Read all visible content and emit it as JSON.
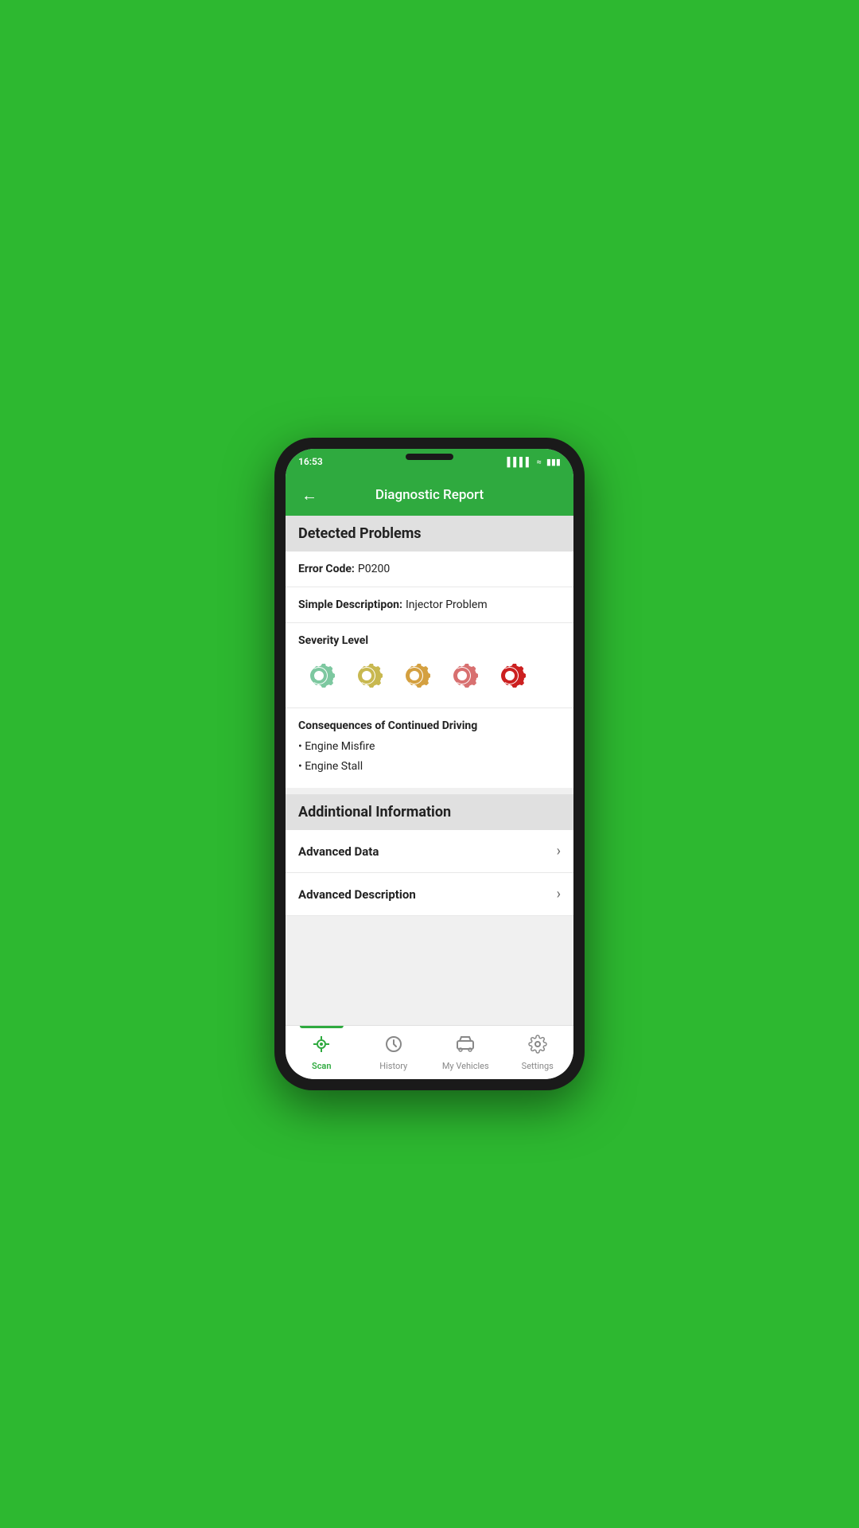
{
  "status_bar": {
    "time": "16:53"
  },
  "header": {
    "title": "Diagnostic Report",
    "back_label": "←"
  },
  "detected_problems": {
    "section_title": "Detected Problems",
    "error_code_label": "Error Code:",
    "error_code_value": "P0200",
    "simple_description_label": "Simple Descriptipon:",
    "simple_description_value": "Injector Problem",
    "severity_label": "Severity Level",
    "severity_levels": [
      {
        "color": "#7dc8a0",
        "active": false
      },
      {
        "color": "#c8b850",
        "active": false
      },
      {
        "color": "#d4a040",
        "active": false
      },
      {
        "color": "#d87070",
        "active": false
      },
      {
        "color": "#cc2020",
        "active": true
      }
    ],
    "consequences_title": "Consequences of Continued Driving",
    "consequences": [
      "Engine Misfire",
      "Engine Stall"
    ]
  },
  "additional_info": {
    "section_title": "Addintional Information",
    "items": [
      {
        "label": "Advanced Data",
        "id": "advanced-data"
      },
      {
        "label": "Advanced Description",
        "id": "advanced-description"
      }
    ]
  },
  "bottom_nav": {
    "items": [
      {
        "id": "scan",
        "label": "Scan",
        "active": true
      },
      {
        "id": "history",
        "label": "History",
        "active": false
      },
      {
        "id": "my-vehicles",
        "label": "My Vehicles",
        "active": false
      },
      {
        "id": "settings",
        "label": "Settings",
        "active": false
      }
    ]
  }
}
